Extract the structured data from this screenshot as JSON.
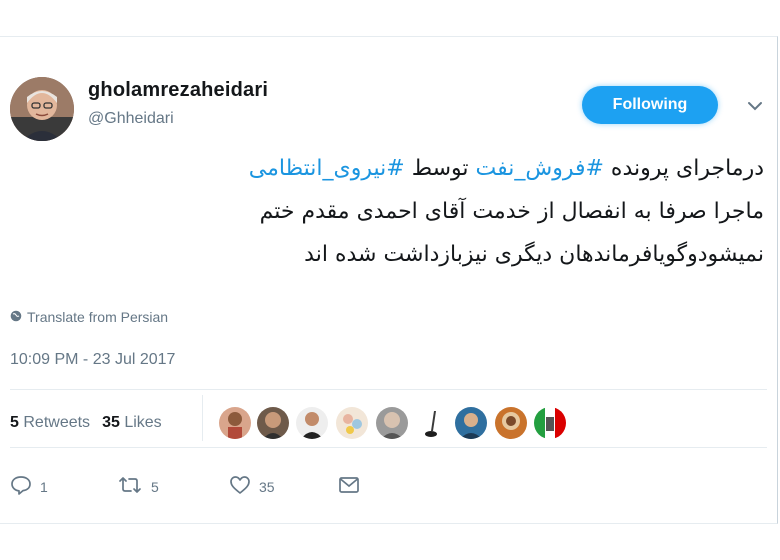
{
  "user": {
    "display_name": "gholamrezaheidari",
    "handle": "@Ghheidari",
    "follow_label": "Following"
  },
  "tweet": {
    "lines": [
      [
        {
          "text": "درماجرای پرونده ",
          "hashtag": false
        },
        {
          "text": "#فروش_نفت",
          "hashtag": true
        },
        {
          "text": " توسط ",
          "hashtag": false
        },
        {
          "text": "#نیروی_انتظامی",
          "hashtag": true
        }
      ],
      [
        {
          "text": "ماجرا صرفا به انفصال از خدمت آقای احمدی مقدم ختم",
          "hashtag": false
        }
      ],
      [
        {
          "text": "نمیشودوگویافرماندهان دیگری نیزبازداشت شده اند",
          "hashtag": false
        }
      ]
    ],
    "translate_label": "Translate from Persian",
    "timestamp": "10:09 PM - 23 Jul 2017"
  },
  "stats": {
    "retweets_count": "5",
    "retweets_label": "Retweets",
    "likes_count": "35",
    "likes_label": "Likes",
    "liker_avatars": 9
  },
  "actions": {
    "reply_count": "1",
    "retweet_count": "5",
    "like_count": "35"
  },
  "colors": {
    "accent": "#1da1f2",
    "hashtag": "#1b95e0",
    "muted": "#657786"
  },
  "icons": [
    "chevron-down-icon",
    "globe-icon",
    "reply-icon",
    "retweet-icon",
    "heart-icon",
    "message-icon"
  ]
}
